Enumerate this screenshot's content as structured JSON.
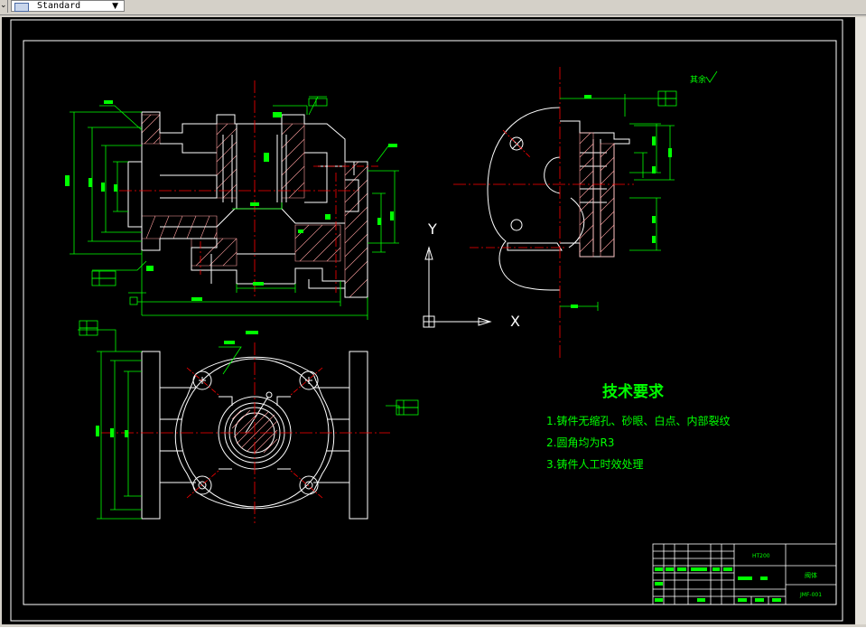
{
  "toolbar": {
    "style_combo": {
      "value": "Standard",
      "icon": "text-style-icon",
      "arrow": "▼"
    },
    "left_glyph": "⌄"
  },
  "drawing": {
    "axis_y_label": "Y",
    "axis_x_label": "X",
    "roughness_note": "其余",
    "tech_title": "技术要求",
    "tech_items": [
      "1.铸件无缩孔、砂眼、白点、内部裂纹",
      "2.圆角均为R3",
      "3.铸件人工时效处理"
    ],
    "title_block": {
      "part_name": "阀体",
      "drawing_no": "JMF-001",
      "material": "HT200"
    }
  },
  "colors": {
    "background": "#000000",
    "outline": "#ffffff",
    "dimension": "#00ff00",
    "center_line": "#ff0000",
    "hatch": "#ff9f9f",
    "frame": "#ffffff"
  }
}
